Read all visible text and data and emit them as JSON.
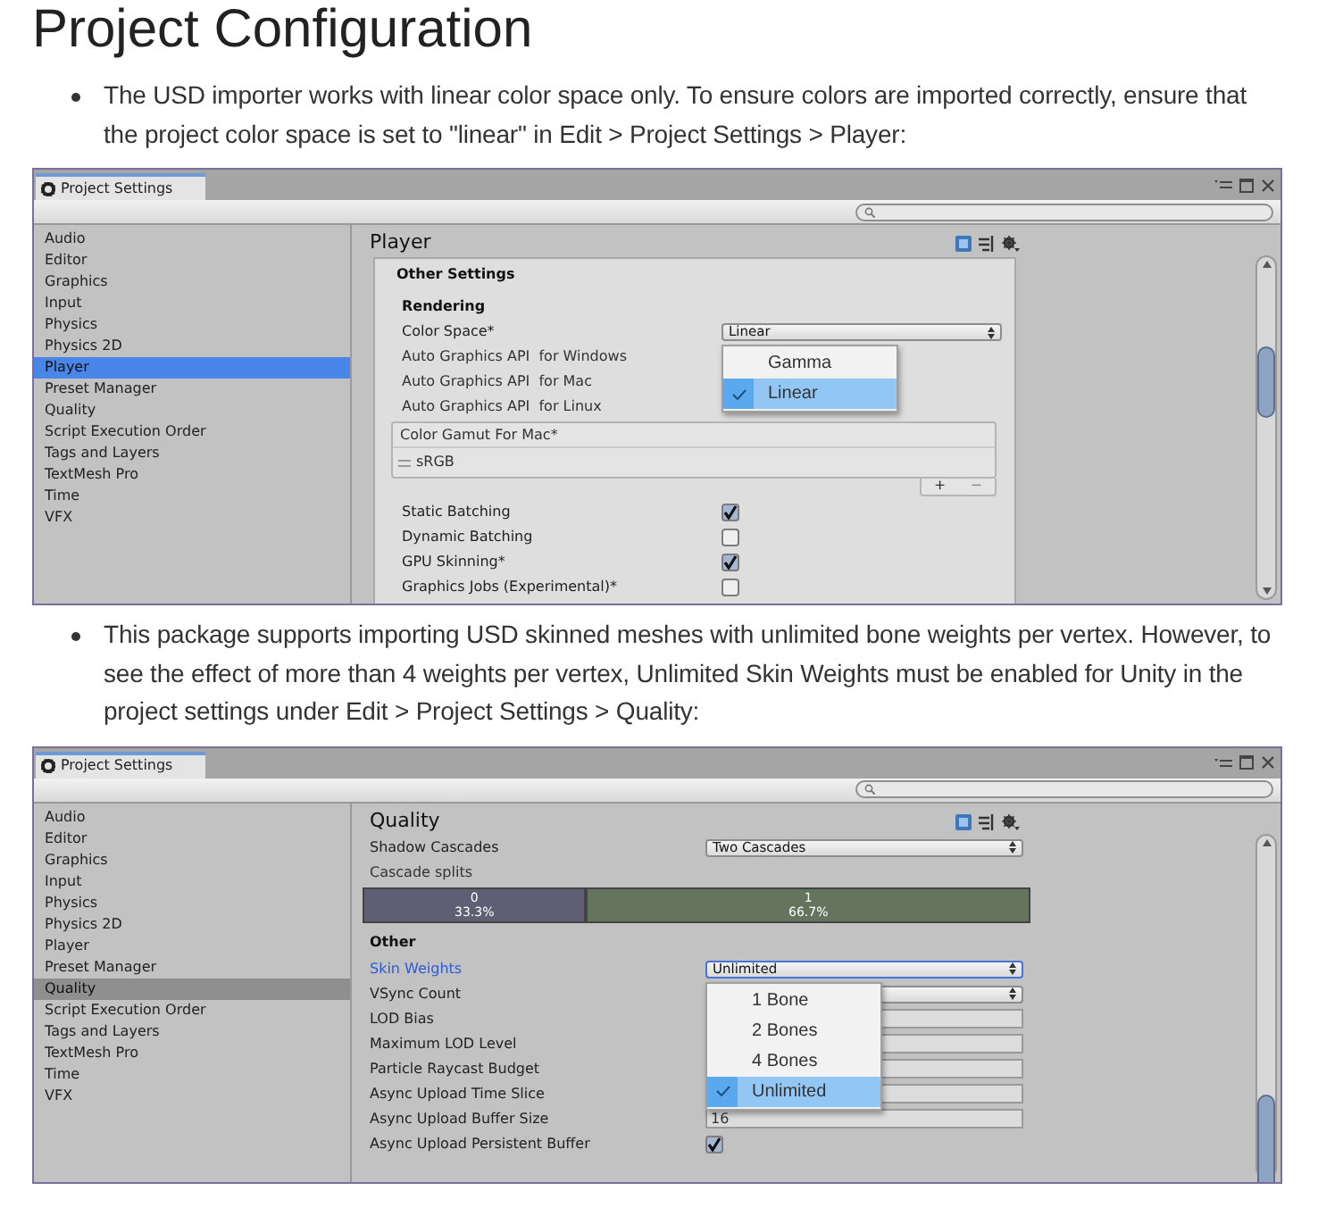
{
  "heading": "Project Configuration",
  "sections": [
    {
      "text": "The USD importer works with linear color space only. To ensure colors are imported correctly, ensure that the project color space is set to \"linear\" in Edit > Project Settings > Player:",
      "window": {
        "tab": "Project Settings",
        "sidebar": {
          "focused": true,
          "items": [
            {
              "label": "Audio",
              "selected": false
            },
            {
              "label": "Editor",
              "selected": false
            },
            {
              "label": "Graphics",
              "selected": false
            },
            {
              "label": "Input",
              "selected": false
            },
            {
              "label": "Physics",
              "selected": false
            },
            {
              "label": "Physics 2D",
              "selected": false
            },
            {
              "label": "Player",
              "selected": true
            },
            {
              "label": "Preset Manager",
              "selected": false
            },
            {
              "label": "Quality",
              "selected": false
            },
            {
              "label": "Script Execution Order",
              "selected": false
            },
            {
              "label": "Tags and Layers",
              "selected": false
            },
            {
              "label": "TextMesh Pro",
              "selected": false
            },
            {
              "label": "Time",
              "selected": false
            },
            {
              "label": "VFX",
              "selected": false
            }
          ]
        },
        "panel": {
          "title": "Player",
          "boxed": true,
          "rows": [
            {
              "kind": "section",
              "label": "Other Settings"
            },
            {
              "kind": "subsection",
              "label": "Rendering"
            },
            {
              "kind": "dropdown",
              "label": "Color Space*",
              "value": "Linear",
              "focused": false,
              "menu": [
                {
                  "label": "Gamma",
                  "selected": false
                },
                {
                  "label": "Linear",
                  "selected": true
                }
              ]
            },
            {
              "kind": "label",
              "label": "Auto Graphics API  for Windows"
            },
            {
              "kind": "label",
              "label": "Auto Graphics API  for Mac"
            },
            {
              "kind": "label",
              "label": "Auto Graphics API  for Linux"
            },
            {
              "kind": "list",
              "label": "Color Gamut For Mac*",
              "items": [
                "sRGB"
              ],
              "add": "+",
              "remove": "−"
            },
            {
              "kind": "checkbox",
              "label": "Static Batching",
              "checked": true
            },
            {
              "kind": "checkbox",
              "label": "Dynamic Batching",
              "checked": false
            },
            {
              "kind": "checkbox",
              "label": "GPU Skinning*",
              "checked": true
            },
            {
              "kind": "checkbox",
              "label": "Graphics Jobs (Experimental)*",
              "checked": false
            }
          ]
        }
      }
    },
    {
      "text": "This package supports importing USD skinned meshes with unlimited bone weights per vertex. However, to see the effect of more than 4 weights per vertex, Unlimited Skin Weights must be enabled for Unity in the project settings under Edit > Project Settings > Quality:",
      "window": {
        "tab": "Project Settings",
        "sidebar": {
          "focused": false,
          "items": [
            {
              "label": "Audio",
              "selected": false
            },
            {
              "label": "Editor",
              "selected": false
            },
            {
              "label": "Graphics",
              "selected": false
            },
            {
              "label": "Input",
              "selected": false
            },
            {
              "label": "Physics",
              "selected": false
            },
            {
              "label": "Physics 2D",
              "selected": false
            },
            {
              "label": "Player",
              "selected": false
            },
            {
              "label": "Preset Manager",
              "selected": false
            },
            {
              "label": "Quality",
              "selected": true
            },
            {
              "label": "Script Execution Order",
              "selected": false
            },
            {
              "label": "Tags and Layers",
              "selected": false
            },
            {
              "label": "TextMesh Pro",
              "selected": false
            },
            {
              "label": "Time",
              "selected": false
            },
            {
              "label": "VFX",
              "selected": false
            }
          ]
        },
        "panel": {
          "title": "Quality",
          "boxed": false,
          "rows": [
            {
              "kind": "dropdown",
              "label": "Shadow Cascades",
              "value": "Two Cascades",
              "focused": false
            },
            {
              "kind": "label",
              "label": "Cascade splits"
            },
            {
              "kind": "splits",
              "segments": [
                {
                  "label": "0",
                  "percent": "33.3%",
                  "level": 0.333
                },
                {
                  "label": "1",
                  "percent": "66.7%",
                  "level": 0.667
                }
              ]
            },
            {
              "kind": "section",
              "label": "Other"
            },
            {
              "kind": "dropdown",
              "label": "Skin Weights",
              "value": "Unlimited",
              "focused": true,
              "menu": [
                {
                  "label": "1 Bone",
                  "selected": false
                },
                {
                  "label": "2 Bones",
                  "selected": false
                },
                {
                  "label": "4 Bones",
                  "selected": false
                },
                {
                  "label": "Unlimited",
                  "selected": true
                }
              ]
            },
            {
              "kind": "dropdown",
              "label": "VSync Count",
              "focused": false
            },
            {
              "kind": "field",
              "label": "LOD Bias"
            },
            {
              "kind": "field",
              "label": "Maximum LOD Level"
            },
            {
              "kind": "field",
              "label": "Particle Raycast Budget"
            },
            {
              "kind": "field",
              "label": "Async Upload Time Slice"
            },
            {
              "kind": "field",
              "label": "Async Upload Buffer Size",
              "value": "16"
            },
            {
              "kind": "checkbox",
              "label": "Async Upload Persistent Buffer",
              "checked": true
            }
          ]
        }
      }
    }
  ]
}
